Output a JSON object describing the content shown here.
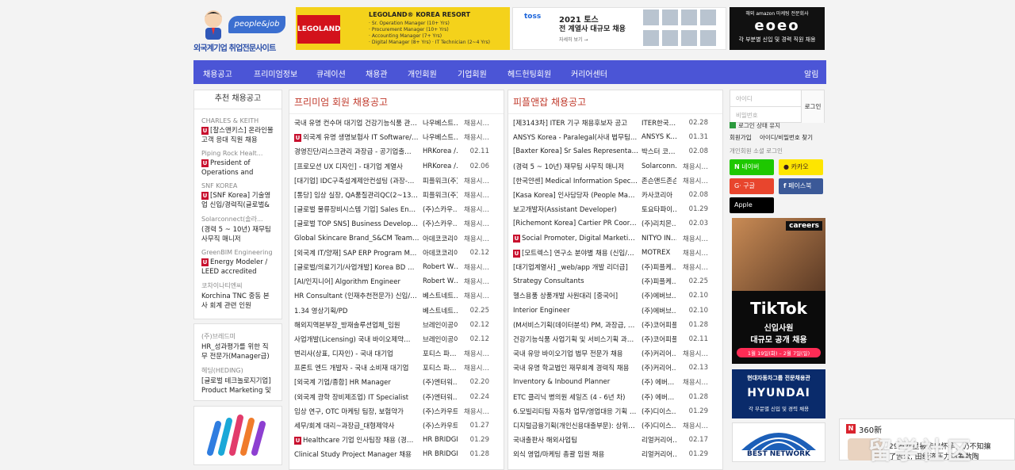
{
  "logo": {
    "brand": "people&job",
    "tagline": "외국계기업 취업전문사이트"
  },
  "banners": {
    "lego": {
      "title": "LEGOLAND® KOREA RESORT",
      "logo_text": "LEGOLAND",
      "lines": [
        "· Sr. Operation Manager (10+ Yrs)",
        "· Procurement Manager (10+ Yrs)",
        "· Accounting Manager (7+ Yrs)",
        "· Digital Manager (8+ Yrs)   · IT Technician (2~4 Yrs)"
      ]
    },
    "toss": {
      "brand": "toss",
      "title": "2021 토스",
      "subtitle": "전 계열사 대규모 채용",
      "link": "자세히 보기 →"
    },
    "amazon": {
      "top": "해외 amazon 마케팅 전문회사",
      "brand": "eoeo",
      "bottom": "각 부분별 신입 및 경력 직원 채용"
    }
  },
  "nav": [
    "채용공고",
    "프리미엄정보",
    "큐레이션",
    "채용관",
    "개인회원",
    "기업회원",
    "헤드헌팅회원",
    "커리어센터",
    "알림"
  ],
  "recommend": {
    "title": "추천 채용공고",
    "items": [
      {
        "company": "CHARLES & KEITH",
        "title": "[찰스앤키스] 온라인몰 고객 응대 직원 채용",
        "u": true
      },
      {
        "company": "Piping Rock Healt...",
        "title": "President of Operations and",
        "u": true
      },
      {
        "company": "SNF KOREA",
        "title": "[SNF Korea] 기술영업 신입/경력직(글로벌&국내 수처",
        "u": true
      },
      {
        "company": "Solarconnect(솔라...",
        "title": "(경력 5 ~ 10년) 재무팀 사무직 매니저",
        "u": false
      },
      {
        "company": "GreenBIM Engineering",
        "title": "Energy Modeler / LEED accredited",
        "u": true
      },
      {
        "company": "코차이나티엔씨",
        "title": "Korchina TNC 중동 본사 회계 관련 인원",
        "u": false
      }
    ],
    "items2": [
      {
        "company": "(주)브레드미",
        "title": "HR_성과평가를 위한 직무 전문가(Manager급)"
      },
      {
        "company": "헤딩(HEDING)",
        "title": "[글로벌 테크놀로지기업] Product Marketing 및"
      }
    ]
  },
  "premium": {
    "title": "프리미엄 회원 채용공고",
    "rows": [
      {
        "t": "국내 유명 컨수머 대기업 건강기능식품 관…",
        "c": "나우베스트…",
        "d": "채용시…",
        "u": false
      },
      {
        "t": "외국계 유명 생명보험사 IT Software/…",
        "c": "나우베스트…",
        "d": "채용시…",
        "u": true
      },
      {
        "t": "경영진단/리스크관리 과장급 - 공기업출…",
        "c": "HRKorea /…",
        "d": "02.11",
        "u": false
      },
      {
        "t": "[프로모션 UX 디자인] - 대기업 계열사",
        "c": "HRKorea /…",
        "d": "02.06",
        "u": false
      },
      {
        "t": "[대기업] IDC구축설계제안컨설팅 (과장-…",
        "c": "피플워크(주)",
        "d": "채용시…",
        "u": false
      },
      {
        "t": "[통당] 임상 실장, QA품질관리QC(2~13…",
        "c": "피플워크(주)",
        "d": "채용시…",
        "u": false
      },
      {
        "t": "[글로벌 물류장비시스템 기업] Sales En…",
        "c": "(주)스카우…",
        "d": "채용시…",
        "u": false
      },
      {
        "t": "[글로벌 TOP SNS] Business Develop…",
        "c": "(주)스카우…",
        "d": "채용시…",
        "u": false
      },
      {
        "t": "Global Skincare Brand_S&CM Team …",
        "c": "아데코코리아",
        "d": "채용시…",
        "u": false
      },
      {
        "t": "[외국계 IT/양재] SAP ERP Program M…",
        "c": "아데코코리아",
        "d": "02.12",
        "u": false
      },
      {
        "t": "[글로벌/의료기기/사업개발] Korea BD …",
        "c": "Robert W…",
        "d": "채용시…",
        "u": false
      },
      {
        "t": "[AI/인지니어] Algorithm Engineer",
        "c": "Robert W…",
        "d": "채용시…",
        "u": false
      },
      {
        "t": "HR Consultant (인재추천전문가) 신입/…",
        "c": "베스트네트…",
        "d": "채용시…",
        "u": false
      },
      {
        "t": "1.34 영상기획/PD",
        "c": "베스트네트…",
        "d": "02.25",
        "u": false
      },
      {
        "t": "해외지역본부장_방재솔루션업체_임원",
        "c": "브레인이공이",
        "d": "02.12",
        "u": false
      },
      {
        "t": "사업개발(Licensing) 국내 바이오제약…",
        "c": "브레인이공이",
        "d": "02.12",
        "u": false
      },
      {
        "t": "변리사(상표, 디자인) - 국내 대기업",
        "c": "포티스 파…",
        "d": "채용시…",
        "u": false
      },
      {
        "t": "프론트 엔드 개발자 - 국내 소비재 대기업",
        "c": "포티스 파…",
        "d": "채용시…",
        "u": false
      },
      {
        "t": "[외국계 기업/종합] HR Manager",
        "c": "(주)엔터워…",
        "d": "02.20",
        "u": false
      },
      {
        "t": "(외국계 광학 장비제조업) IT Specialist",
        "c": "(주)엔터워…",
        "d": "02.24",
        "u": false
      },
      {
        "t": "임상 연구, OTC 마케팅 팀장, 보험약가",
        "c": "(주)스카우트",
        "d": "채용시…",
        "u": false
      },
      {
        "t": "세무/회계 대리~과장급_대형제약사",
        "c": "(주)스카우트",
        "d": "01.27",
        "u": false
      },
      {
        "t": "Healthcare 기업 인사팀장 채용 (경기…",
        "c": "HR BRIDGE",
        "d": "01.29",
        "u": true
      },
      {
        "t": "Clinical Study Project Manager 채용",
        "c": "HR BRIDGE",
        "d": "01.28",
        "u": false
      }
    ]
  },
  "pickup": {
    "title": "피플앤잡 채용공고",
    "rows": [
      {
        "t": "[제3143차] ITER 기구 채용후보자 공고",
        "c": "ITER한국…",
        "d": "02.28",
        "u": false
      },
      {
        "t": "ANSYS Korea - Paralegal(사내 법무팀 …",
        "c": "ANSYS K…",
        "d": "01.31",
        "u": false
      },
      {
        "t": "[Baxter Korea] Sr Sales Representativ…",
        "c": "박스터 코…",
        "d": "02.08",
        "u": false
      },
      {
        "t": "(경력 5 ~ 10년) 재무팀 사무직 매니저",
        "c": "Solarconn…",
        "d": "채용시…",
        "u": false
      },
      {
        "t": "[한국얀센] Medical Information Specialist",
        "c": "존슨앤드존슨",
        "d": "채용시…",
        "u": false
      },
      {
        "t": "[Kasa Korea] 인사담당자 (People Mana…",
        "c": "카사코리아",
        "d": "02.08",
        "u": false
      },
      {
        "t": "보고개발자(Assistant Developer)",
        "c": "토요타파이…",
        "d": "01.29",
        "u": false
      },
      {
        "t": "[Richemont Korea] Cartier PR Coordin…",
        "c": "(주)리치몬…",
        "d": "02.03",
        "u": false
      },
      {
        "t": "Social Promoter, Digital Marketing …",
        "c": "NITYO IN…",
        "d": "채용시…",
        "u": true
      },
      {
        "t": "[모트렉스] 연구소 분야별 채용 (신입/경…",
        "c": "MOTREX",
        "d": "채용시…",
        "u": true
      },
      {
        "t": "[대기업계열사] _web/app 개발 리더급]",
        "c": "(주)피플케…",
        "d": "채용시…",
        "u": false
      },
      {
        "t": "Strategy Consultants",
        "c": "(주)피플케…",
        "d": "02.25",
        "u": false
      },
      {
        "t": "헬스용품 상품개발 사원대리 [중국어]",
        "c": "(주)에버브…",
        "d": "02.10",
        "u": false
      },
      {
        "t": "Interior Engineer",
        "c": "(주)에버브…",
        "d": "02.10",
        "u": false
      },
      {
        "t": "(M서비스기획(데이터분석) PM, 과장급, 국…",
        "c": "(주)코어피플",
        "d": "01.28",
        "u": false
      },
      {
        "t": "건강기능식품 사업기획 및 서비스기획 과정급",
        "c": "(주)코어피플",
        "d": "02.11",
        "u": false
      },
      {
        "t": "국내 유망 바이오기업 법무 전문가 채용",
        "c": "(주)커리어…",
        "d": "채용시…",
        "u": false
      },
      {
        "t": "국내 유명 학교법인 재무회계 경력직 채용",
        "c": "(주)커리어…",
        "d": "02.13",
        "u": false
      },
      {
        "t": "Inventory & Inbound Planner",
        "c": "(주) 에버…",
        "d": "채용시…",
        "u": false
      },
      {
        "t": "ETC 클리닉 병의원 세일즈 (4 - 6년 차)",
        "c": "(주) 에버…",
        "d": "01.28",
        "u": false
      },
      {
        "t": "6.모빌리티팀 자동차 업무/영업대응 기획 및…",
        "c": "(주)디이스…",
        "d": "01.29",
        "u": false
      },
      {
        "t": "디지털금융기획(개인신용대출부문): 상위권…",
        "c": "(주)디이스…",
        "d": "채용시…",
        "u": false
      },
      {
        "t": "국내출판사 해외사업팀",
        "c": "리얼커리어…",
        "d": "02.17",
        "u": false
      },
      {
        "t": "외식 영업/마케팅 총괄 임원 채용",
        "c": "리얼커리어…",
        "d": "01.29",
        "u": false
      }
    ]
  },
  "login": {
    "id_placeholder": "아이디",
    "pw_placeholder": "비밀번호",
    "button": "로그인",
    "keep": "로그인 상태 유지",
    "join": "회원가입",
    "find": "아이디/비밀번호 찾기",
    "social_title": "개인회원 소셜 로그인",
    "naver": "네이버",
    "kakao": "카카오",
    "google": "구글",
    "facebook": "페이스북",
    "apple": "Apple"
  },
  "ads": {
    "careers": "careers",
    "tiktok": "TikTok",
    "tiktok_sub1": "신입사원",
    "tiktok_sub2": "대규모 공개 채용",
    "tiktok_date": "1월 19일(화) – 2월 7일(일)",
    "hyundai_top": "현대자동차그룹 전문채용관",
    "hyundai": "HYUNDAI",
    "hyundai_sub": "각 부문별 신입 및 경력 채용",
    "best": "BEST NETWORK"
  },
  "news": {
    "badge": "N",
    "source": "360新",
    "line1": "29岁女星被传出怀孕，仍不知攘",
    "line2": "了告公, 田经济压力请筹数陶"
  },
  "watermark": "留学社区"
}
